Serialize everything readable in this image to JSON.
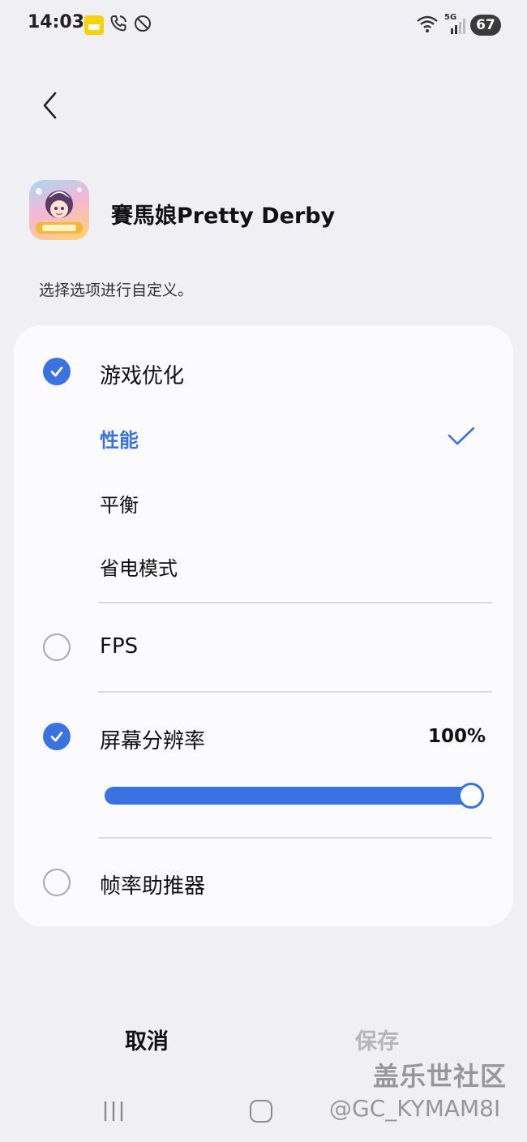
{
  "status_bar": {
    "time": "14:03",
    "network_label": "5G",
    "battery_level": "67"
  },
  "app": {
    "name": "賽馬娘Pretty Derby",
    "instruction": "选择选项进行自定义。"
  },
  "options": {
    "game_optimization": {
      "label": "游戏优化",
      "checked": true,
      "modes": [
        {
          "label": "性能",
          "selected": true
        },
        {
          "label": "平衡",
          "selected": false
        },
        {
          "label": "省电模式",
          "selected": false
        }
      ]
    },
    "fps": {
      "label": "FPS",
      "checked": false
    },
    "resolution": {
      "label": "屏幕分辨率",
      "checked": true,
      "value_text": "100%",
      "level": 1.0
    },
    "frame_booster": {
      "label": "帧率助推器",
      "checked": false
    }
  },
  "footer": {
    "cancel_label": "取消",
    "save_label": "保存"
  },
  "watermark": {
    "title": "盖乐世社区",
    "handle": "@GC_KYMAM8I"
  },
  "colors": {
    "accent": "#3a72e2",
    "background": "#f0f0f4",
    "card": "#fbfbfd",
    "disabled_text": "#b6b6ba"
  },
  "icons": {
    "back": "chevron-left-icon",
    "checked": "check-circle-icon",
    "unchecked": "empty-circle-icon",
    "selected_mode": "checkmark-icon"
  }
}
